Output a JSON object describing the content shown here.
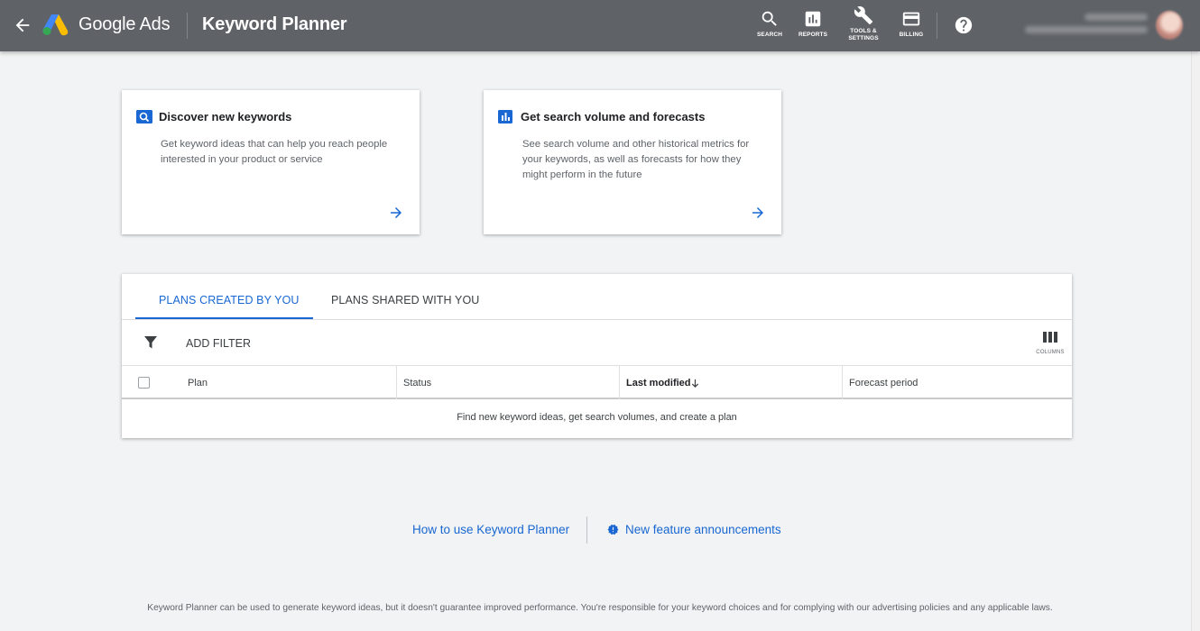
{
  "header": {
    "brand": "Google Ads",
    "title": "Keyword Planner",
    "buttons": {
      "search": "SEARCH",
      "reports": "REPORTS",
      "tools_line1": "TOOLS &",
      "tools_line2": "SETTINGS",
      "billing": "BILLING"
    },
    "icons": [
      "back-arrow-icon",
      "google-ads-logo",
      "search-icon",
      "reports-icon",
      "wrench-icon",
      "credit-card-icon",
      "help-icon"
    ]
  },
  "cards": [
    {
      "title": "Discover new keywords",
      "description": "Get keyword ideas that can help you reach people interested in your product or service"
    },
    {
      "title": "Get search volume and forecasts",
      "description": "See search volume and other historical metrics for your keywords, as well as forecasts for how they might perform in the future"
    }
  ],
  "plans": {
    "tabs": [
      {
        "label": "PLANS CREATED BY YOU",
        "selected": true
      },
      {
        "label": "PLANS SHARED WITH YOU",
        "selected": false
      }
    ],
    "filter_label": "ADD FILTER",
    "columns_label": "COLUMNS",
    "columns": [
      "Plan",
      "Status",
      "Last modified",
      "Forecast period"
    ],
    "sorted_column": "Last modified",
    "empty_message": "Find new keyword ideas, get search volumes, and create a plan"
  },
  "links": {
    "how_to": "How to use Keyword Planner",
    "announcements": "New feature announcements"
  },
  "disclaimer": "Keyword Planner can be used to generate keyword ideas, but it doesn't guarantee improved performance. You're responsible for your keyword choices and for complying with our advertising policies and any applicable laws.",
  "colors": {
    "header_bg": "#5f6368",
    "page_bg": "#f1f3f4",
    "accent": "#1967d2"
  }
}
